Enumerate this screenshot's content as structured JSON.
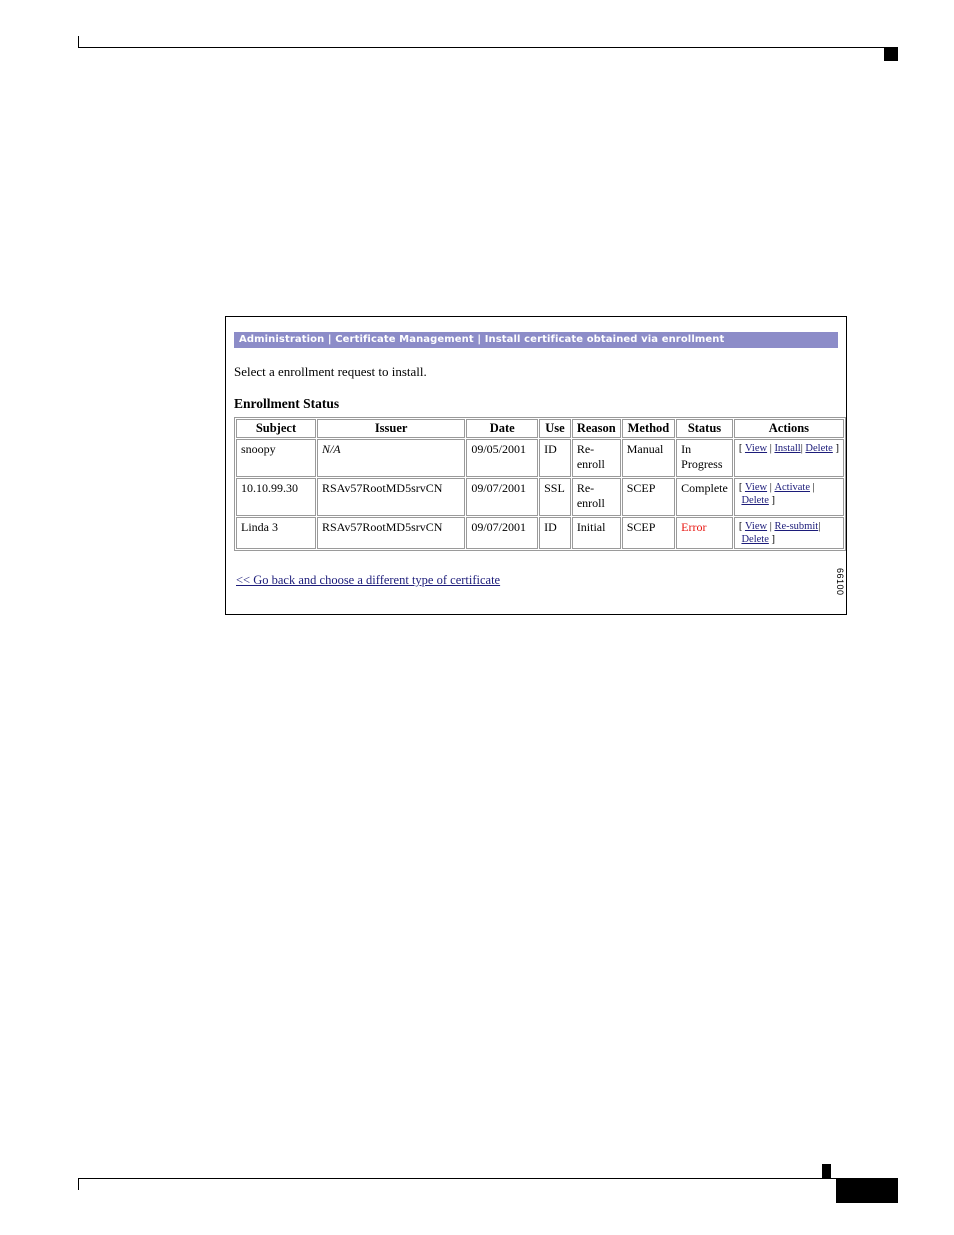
{
  "page": {
    "art_id": "66100"
  },
  "figure": {
    "banner": {
      "breadcrumb": "Administration | Certificate Management | Install certificate obtained via enrollment",
      "background_color": "#8c8cc8",
      "text_color": "#ffffff"
    },
    "instruction": "Select a enrollment request to install.",
    "section_heading": "Enrollment Status",
    "back_link": "<< Go back and choose a different type of certificate",
    "link_color": "#1c1c7a",
    "error_color": "#e8140f"
  },
  "table": {
    "columns": [
      "Subject",
      "Issuer",
      "Date",
      "Use",
      "Reason",
      "Method",
      "Status",
      "Actions"
    ],
    "rows": [
      {
        "subject": "snoopy",
        "issuer": "N/A",
        "issuer_italic": true,
        "date": "09/05/2001",
        "use": "ID",
        "reason": "Re-enroll",
        "method": "Manual",
        "status": "In Progress",
        "status_error": false,
        "actions": [
          "View",
          "Install",
          "Delete"
        ]
      },
      {
        "subject": "10.10.99.30",
        "issuer": "RSAv57RootMD5srvCN",
        "issuer_italic": false,
        "date": "09/07/2001",
        "use": "SSL",
        "reason": "Re-enroll",
        "method": "SCEP",
        "status": "Complete",
        "status_error": false,
        "actions": [
          "View",
          "Activate",
          "Delete"
        ]
      },
      {
        "subject": "Linda 3",
        "issuer": "RSAv57RootMD5srvCN",
        "issuer_italic": false,
        "date": "09/07/2001",
        "use": "ID",
        "reason": "Initial",
        "method": "SCEP",
        "status": "Error",
        "status_error": true,
        "actions": [
          "View",
          "Re-submit",
          "Delete"
        ]
      }
    ]
  }
}
